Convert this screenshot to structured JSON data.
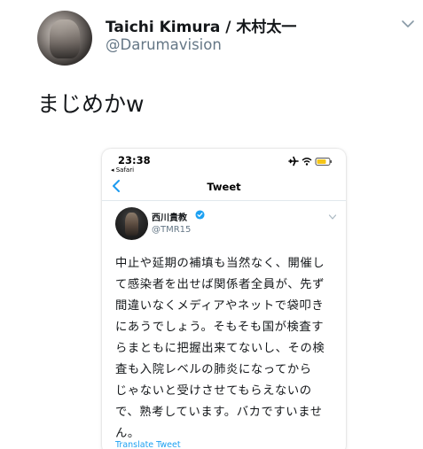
{
  "outer_tweet": {
    "author_name": "Taichi Kimura / 木村太一",
    "author_handle": "@Darumavision",
    "text": "まじめかw"
  },
  "embedded_screenshot": {
    "status_bar": {
      "time": "23:38",
      "back_to_app": "◂ Safari"
    },
    "nav": {
      "title": "Tweet"
    },
    "tweet": {
      "author_name": "西川貴教",
      "author_handle": "@TMR15",
      "lines": [
        "中止や延期の補填も当然なく、開催し",
        "て感染者を出せば関係者全員が、先ず",
        "間違いなくメディアやネットで袋叩き",
        "にあうでしょう。そもそも国が検査す",
        "らまともに把握出来てないし、その検",
        "査も入院レベルの肺炎になってから",
        "じゃないと受けさせてもらえないの",
        "で、熟考しています。バカですいませ",
        "ん。"
      ],
      "translate_label": "Translate Tweet"
    }
  },
  "colors": {
    "text_primary": "#14171a",
    "text_secondary": "#657786",
    "link_blue": "#1da1f2",
    "ios_blue": "#1d9bf0",
    "battery_yellow": "#f5c518"
  },
  "icons": [
    "chevron-down-icon",
    "airplane-icon",
    "wifi-icon",
    "battery-icon",
    "back-chevron-icon",
    "verified-badge-icon"
  ]
}
